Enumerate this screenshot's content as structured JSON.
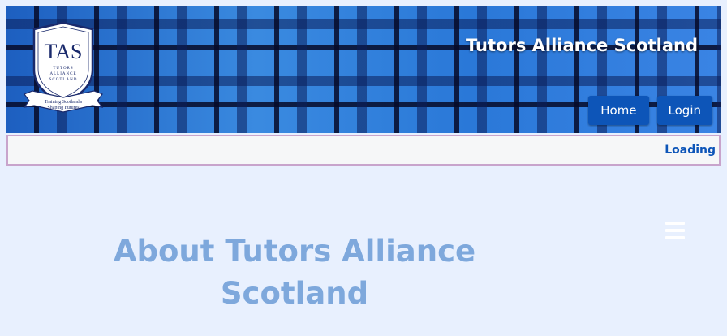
{
  "header": {
    "logo": {
      "initials": "TAS",
      "subtitle_line1": "TUTORS",
      "subtitle_line2": "ALLIANCE",
      "subtitle_line3": "SCOTLAND",
      "ribbon_line1": "Training Scotland's",
      "ribbon_line2": "Shaping Futures"
    },
    "site_title": "Tutors Alliance Scotland",
    "nav": [
      {
        "label": "Home"
      },
      {
        "label": "Login"
      }
    ]
  },
  "status_bar": {
    "text": "Loading"
  },
  "main": {
    "heading": "About Tutors Alliance Scotland",
    "menu_icon": "hamburger-icon"
  },
  "colors": {
    "header_blue": "#2a6fd0",
    "button_blue": "#0d55b8",
    "page_background": "#e8f0fe",
    "heading_color": "#7ea8dc",
    "status_border": "#c8a4cc"
  }
}
